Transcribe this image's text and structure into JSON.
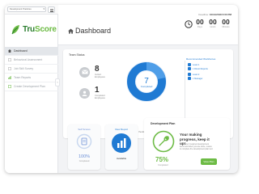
{
  "sidebar": {
    "tab_select": "Development Practices",
    "logo_tru": "Tru",
    "logo_score": "Score",
    "items": [
      {
        "label": "Dashboard"
      },
      {
        "label": "Behavioral Assessment"
      },
      {
        "label": "Job Skill Survey"
      },
      {
        "label": "Team Reports"
      },
      {
        "label": "Create Development Plan"
      }
    ]
  },
  "header": {
    "title": "Dashboard",
    "deadline_label": "Deadline:",
    "deadline_value": "10/14/2018 6:00 PM",
    "countdown": [
      {
        "value": "00",
        "label": "Days"
      },
      {
        "value": "00",
        "label": "Hours"
      },
      {
        "value": "00",
        "label": "Minutes"
      }
    ]
  },
  "team_status": {
    "title": "Team Status",
    "stats": [
      {
        "value": "8",
        "label": "Invited",
        "sub": "Employees"
      },
      {
        "value": "1",
        "label": "Completed",
        "sub": "Employees"
      }
    ],
    "donut_value": "7",
    "donut_label": "Completed",
    "legend": [
      {
        "label": "Created Reports",
        "color": "#1f7ad3"
      },
      {
        "label": "Pending",
        "color": "#4f9ee8"
      },
      {
        "label": "Overview",
        "color": "#9fc9f2"
      }
    ],
    "badges_title": "Recommended Workforces",
    "badges": [
      {
        "label": "Level 1"
      },
      {
        "label": "1 Direct Reports"
      },
      {
        "label": "Level 2"
      },
      {
        "label": "1 Manager"
      }
    ]
  },
  "self_score": {
    "title": "Self Scores",
    "value": "100%",
    "label": "Completed"
  },
  "view_report": {
    "title": "View Report",
    "label": "Available"
  },
  "dev_plan": {
    "title": "Development Plan",
    "headline": "Your making progress, keep it up!",
    "text": "Complete 2 required development items and when you are done, review to complete the development plan tool.",
    "percent": "75%",
    "percent_label": "Completed",
    "button": "View Plan"
  },
  "colors": {
    "brand_dark": "#2a7d2e",
    "brand_light": "#6dbb45",
    "blue": "#1f7ad3",
    "sidebar_active": "#e3e6ea"
  }
}
